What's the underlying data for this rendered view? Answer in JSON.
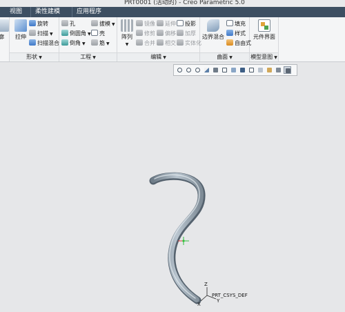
{
  "window": {
    "title": "PRT0001 (活动的) - Creo Parametric 5.0"
  },
  "tabs": [
    {
      "label": "视图"
    },
    {
      "label": "柔性建模"
    },
    {
      "label": "应用程序"
    }
  ],
  "ribbon": {
    "left_partial": {
      "label": "轮廓"
    },
    "shape": {
      "label": "形状",
      "extrude": "拉伸",
      "revolve": "旋转",
      "sweep": "扫描",
      "swept_blend": "扫描混合"
    },
    "engineering": {
      "label": "工程",
      "hole": "孔",
      "round": "倒圆角",
      "chamfer": "倒角",
      "draft": "拔模",
      "shell": "壳",
      "rib": "筋"
    },
    "editing": {
      "label": "编辑",
      "pattern": "阵列",
      "mirror": "镜像",
      "extend": "延伸",
      "project": "投影",
      "trim": "修剪",
      "offset": "偏移",
      "thicken": "加厚",
      "merge": "合并",
      "intersect": "相交",
      "solidify": "实体化"
    },
    "surfaces": {
      "label": "曲面",
      "boundary_blend": "边界混合",
      "fill": "填充",
      "style": "样式",
      "freestyle": "自由式"
    },
    "model_intent": {
      "label": "模型意图",
      "component_interface": "元件界面"
    }
  },
  "viewport": {
    "csys_label": "PRT_CSYS_DEF",
    "axis_z": "Z",
    "axis_x": "X",
    "axis_y": "Y"
  },
  "colors": {
    "tab_bar": "#3d4f62",
    "ribbon_bg": "#f4f5f6",
    "viewport_bg": "#e6e7e9",
    "model_surface": "#8e9ba6"
  }
}
